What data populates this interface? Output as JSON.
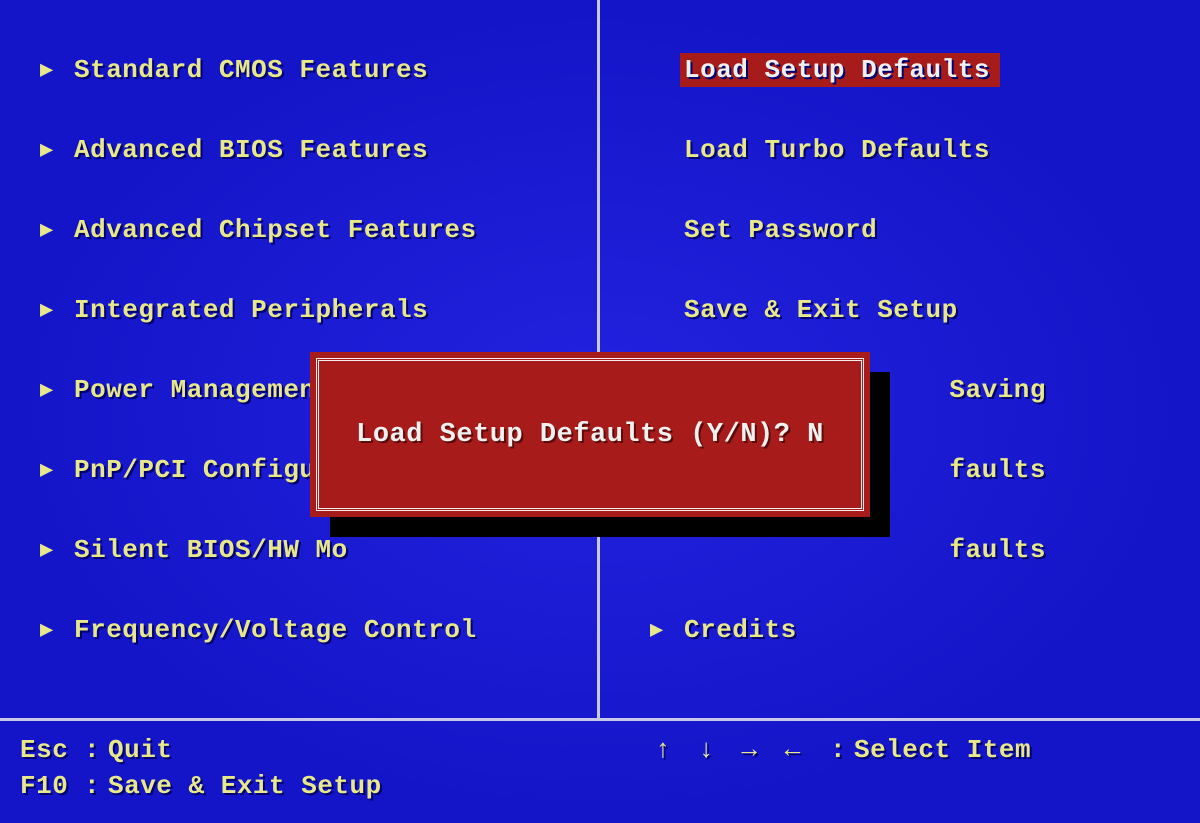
{
  "menu": {
    "left": [
      {
        "label": "Standard CMOS Features",
        "name": "menu-standard-cmos-features"
      },
      {
        "label": "Advanced BIOS Features",
        "name": "menu-advanced-bios-features"
      },
      {
        "label": "Advanced Chipset Features",
        "name": "menu-advanced-chipset-features"
      },
      {
        "label": "Integrated Peripherals",
        "name": "menu-integrated-peripherals"
      },
      {
        "label": "Power Management",
        "name": "menu-power-management"
      },
      {
        "label": "PnP/PCI Configura",
        "name": "menu-pnp-pci-configurations"
      },
      {
        "label": "Silent BIOS/HW Mo",
        "name": "menu-silent-bios-hw-monitor"
      },
      {
        "label": "Frequency/Voltage Control",
        "name": "menu-frequency-voltage-control"
      }
    ],
    "right": [
      {
        "label": "Load Setup Defaults",
        "name": "menu-load-setup-defaults",
        "selected": true,
        "no_arrow": true
      },
      {
        "label": "Load Turbo Defaults",
        "name": "menu-load-turbo-defaults",
        "no_arrow": true
      },
      {
        "label": "Set Password",
        "name": "menu-set-password",
        "no_arrow": true
      },
      {
        "label": "Save & Exit Setup",
        "name": "menu-save-and-exit-setup",
        "no_arrow": true
      },
      {
        "label": "Saving",
        "name": "menu-exit-without-saving",
        "no_arrow": true,
        "pad": true
      },
      {
        "label": "faults",
        "name": "menu-top-performance-defaults",
        "no_arrow": true,
        "pad": true
      },
      {
        "label": "faults",
        "name": "menu-load-bios-defaults",
        "no_arrow": true,
        "pad": true
      },
      {
        "label": "Credits",
        "name": "menu-credits"
      }
    ]
  },
  "dialog": {
    "prompt": "Load Setup Defaults (Y/N)?",
    "value": "N"
  },
  "footer": {
    "esc_key": "Esc",
    "esc_label": "Quit",
    "f10_key": "F10",
    "f10_label": "Save & Exit Setup",
    "arrows_glyphs": "↑ ↓ → ←",
    "select_label": "Select Item",
    "colon": ":"
  },
  "glyphs": {
    "submenu_arrow": "▶"
  }
}
